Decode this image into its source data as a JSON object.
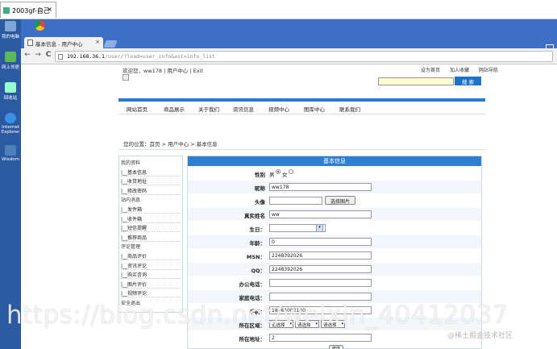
{
  "outer_window": {
    "tab_title": "2003gf-自己",
    "close": "×"
  },
  "desktop_icons": [
    {
      "label": "我的电脑",
      "icon": "computer-icon",
      "color": "#7fa7d8"
    },
    {
      "label": "网上邻居",
      "icon": "network-icon",
      "color": "#5ab95a"
    },
    {
      "label": "回收站",
      "icon": "recycle-bin-icon",
      "color": "#9fc"
    },
    {
      "label": "Internet Explorer",
      "icon": "ie-icon",
      "color": "#3a8fe8"
    },
    {
      "label": "Wisdom",
      "icon": "app-icon",
      "color": "#4f7fb7"
    }
  ],
  "browser": {
    "tab_title": "基本信息 - 用户中心",
    "tab_close": "×",
    "url_host": "192.168.36.1",
    "url_path": "/user/?load=user_info&act=info_list",
    "back": "←",
    "forward": "→",
    "reload": "C"
  },
  "page": {
    "welcome": "欢迎您，ww178 | 用户中心 | Exit",
    "top_links": [
      "设为首页",
      "加入收藏",
      "网站导航"
    ],
    "search_button": "搜 索",
    "search_value": "",
    "nav": [
      "网站首页",
      "商品展示",
      "关于我们",
      "资讯信息",
      "视频中心",
      "图库中心",
      "联系我们"
    ],
    "breadcrumb": "您的位置：首页 > 用户中心 > 基本信息",
    "sidebar": [
      {
        "text": "我的资料",
        "head": true
      },
      {
        "text": "|__基本信息",
        "head": false
      },
      {
        "text": "|__收货地址",
        "head": false
      },
      {
        "text": "|__修改密码",
        "head": false
      },
      {
        "text": "站内消息",
        "head": true
      },
      {
        "text": "|__发件箱",
        "head": false
      },
      {
        "text": "|__收件箱",
        "head": false
      },
      {
        "text": "|__短信提醒",
        "head": false
      },
      {
        "text": "|__推荐商品",
        "head": false
      },
      {
        "text": "评论管理",
        "head": true
      },
      {
        "text": "|__商品评价",
        "head": false
      },
      {
        "text": "|__资讯评论",
        "head": false
      },
      {
        "text": "|__购买咨询",
        "head": false
      },
      {
        "text": "|__图片评价",
        "head": false
      },
      {
        "text": "|__视频评论",
        "head": false
      },
      {
        "text": "安全退出",
        "head": true
      }
    ],
    "panel_title": "基本信息",
    "form": {
      "gender_label": "性别",
      "gender_male": "男",
      "gender_female": "女",
      "gender_selected": "male",
      "nickname_label": "昵称",
      "nickname": "ww178",
      "avatar_label": "头像",
      "avatar_value": "",
      "choose_image": "选择图片",
      "realname_label": "真实姓名",
      "realname": "ww",
      "birthday_label": "生日：",
      "birthday": "",
      "age_label": "年龄：",
      "age": "0",
      "msn_label": "MSN：",
      "msn": "2248392026",
      "qq_label": "QQ：",
      "qq": "2248392026",
      "office_phone_label": "办公电话：",
      "office_phone": "",
      "home_phone_label": "家庭电话：",
      "home_phone": "",
      "mobile_label": "手机：",
      "mobile": "18464002140",
      "region_label": "所在区域：",
      "region_selects": [
        "请选择",
        "请选择",
        "请选择"
      ],
      "address_label": "所在地址：",
      "address": "2",
      "submit": "修改"
    }
  },
  "watermarks": {
    "csdn": "https://blog.csdn.net/weixin_40412037",
    "juejin": "@稀土掘金技术社区"
  }
}
